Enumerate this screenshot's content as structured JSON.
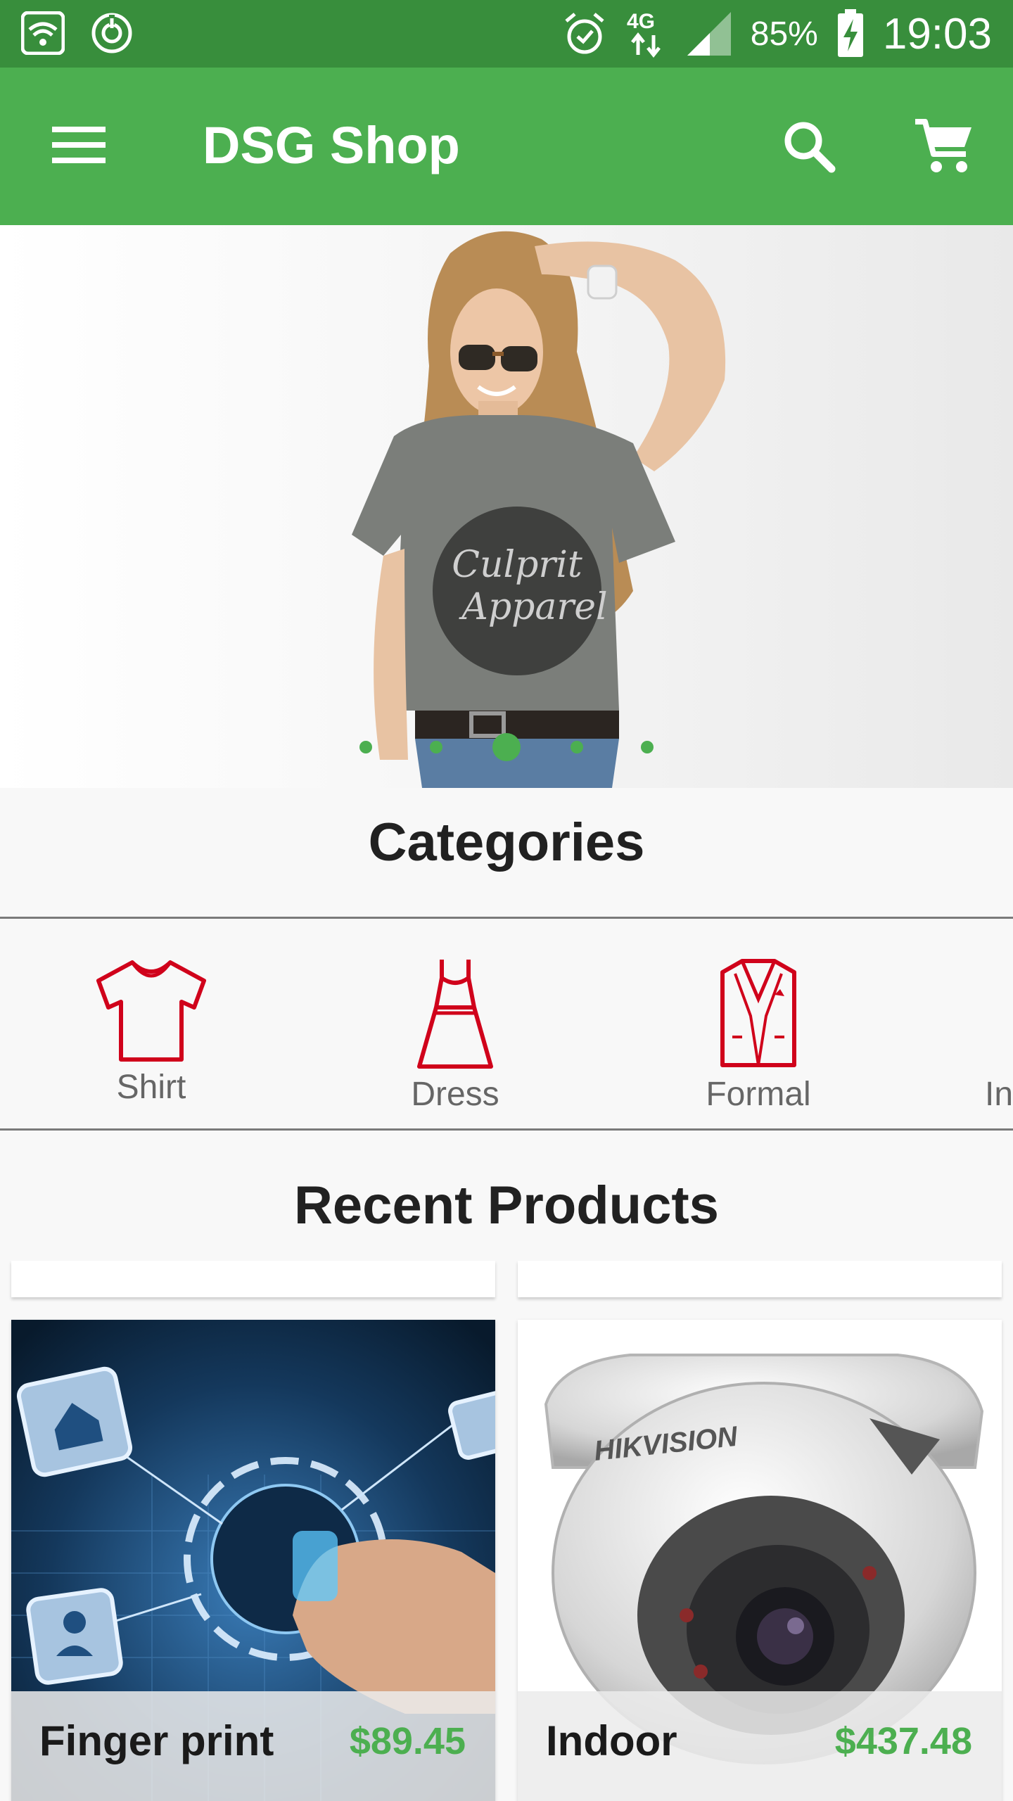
{
  "status_bar": {
    "battery_percent": "85%",
    "time": "19:03",
    "network": "4G",
    "icons": [
      "wifi-icon",
      "sync-icon",
      "alarm-icon",
      "signal-icon",
      "battery-charging-icon"
    ]
  },
  "app_bar": {
    "title": "DSG Shop",
    "icons": [
      "menu-icon",
      "search-icon",
      "cart-icon"
    ]
  },
  "banner": {
    "slide_count": 5,
    "active_slide": 3,
    "shirt_text_line1": "Culprit",
    "shirt_text_line2": "Apparel"
  },
  "categories": {
    "title": "Categories",
    "items": [
      {
        "label": "Shirt",
        "icon": "shirt-icon"
      },
      {
        "label": "Dress",
        "icon": "dress-icon"
      },
      {
        "label": "Formal",
        "icon": "formal-icon"
      },
      {
        "label": "In",
        "icon": "category-icon"
      }
    ]
  },
  "recent_products": {
    "title": "Recent Products",
    "items": [
      {
        "name": "Finger print",
        "price": "$89.45"
      },
      {
        "name": "Indoor",
        "price": "$437.48",
        "brand_text": "HIKVISION"
      }
    ]
  },
  "colors": {
    "primary": "#4caf50",
    "primary_dark": "#388e3c",
    "category_icon": "#d0021b",
    "price": "#4caf50"
  }
}
